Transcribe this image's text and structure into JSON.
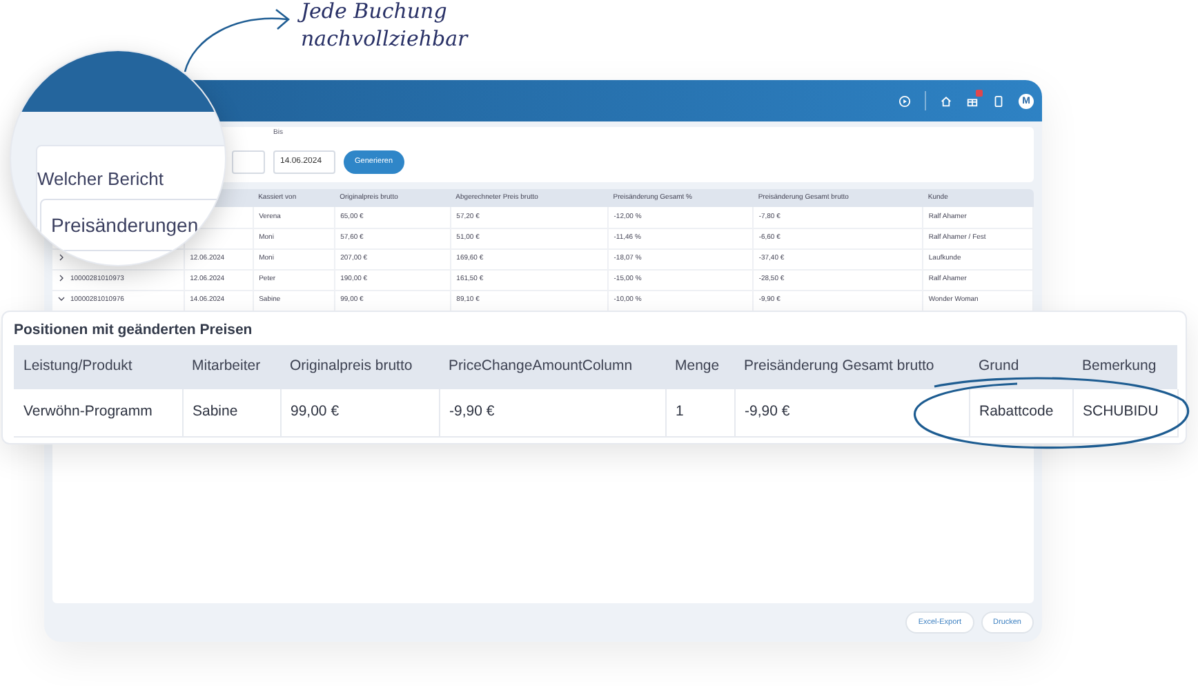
{
  "callout": {
    "text_line_1": "Jede Buchung",
    "text_line_2": "nachvollziehbar"
  },
  "header": {
    "avatar": "M"
  },
  "filter": {
    "bis_label": "Bis",
    "bis_value": "14.06.2024",
    "generate_button": "Generieren"
  },
  "report_table": {
    "columns": [
      null,
      null,
      "Kassiert von",
      "Originalpreis brutto",
      "Abgerechneter Preis brutto",
      "Preisänderung Gesamt %",
      "Preisänderung Gesamt brutto",
      "Kunde"
    ],
    "rows": [
      {
        "cells": [
          null,
          null,
          "Verena",
          "65,00 €",
          "57,20 €",
          "-12,00 %",
          "-7,80 €",
          "Ralf Ahamer"
        ]
      },
      {
        "cells": [
          null,
          null,
          "Moni",
          "57,60 €",
          "51,00 €",
          "-11,46 %",
          "-6,60 €",
          "Ralf Ahamer / Fest"
        ]
      },
      {
        "expanded": false,
        "cells": [
          null,
          "12.06.2024",
          "Moni",
          "207,00 €",
          "169,60 €",
          "-18,07 %",
          "-37,40 €",
          "Laufkunde"
        ]
      },
      {
        "expanded": false,
        "cells": [
          "10000281010973",
          "12.06.2024",
          "Peter",
          "190,00 €",
          "161,50 €",
          "-15,00 %",
          "-28,50 €",
          "Ralf Ahamer"
        ]
      },
      {
        "expanded": true,
        "cells": [
          "10000281010976",
          "14.06.2024",
          "Sabine",
          "99,00 €",
          "89,10 €",
          "-10,00 %",
          "-9,90 €",
          "Wonder Woman"
        ]
      }
    ]
  },
  "magnifier": {
    "label": "Welcher Bericht",
    "value": "Preisänderungen"
  },
  "positions_panel": {
    "title": "Positionen mit geänderten Preisen",
    "columns": [
      "Leistung/Produkt",
      "Mitarbeiter",
      "Originalpreis brutto",
      "PriceChangeAmountColumn",
      "Menge",
      "Preisänderung Gesamt brutto",
      "Grund",
      "Bemerkung"
    ],
    "rows": [
      [
        "Verwöhn-Programm",
        "Sabine",
        "99,00 €",
        "-9,90 €",
        "1",
        "-9,90 €",
        "Rabattcode",
        "SCHUBIDU"
      ]
    ]
  },
  "footer_buttons": [
    "Excel-Export",
    "Drucken"
  ]
}
